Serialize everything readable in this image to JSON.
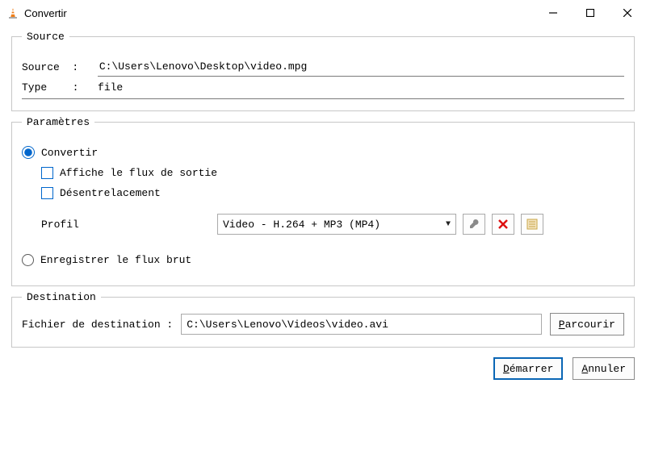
{
  "window": {
    "title": "Convertir",
    "controls": {
      "min": "−",
      "max": "▢",
      "close": "×"
    }
  },
  "source": {
    "legend": "Source",
    "source_label": "Source",
    "source_value": "C:\\Users\\Lenovo\\Desktop\\video.mpg",
    "type_label": "Type",
    "type_value": "file",
    "colon": "  :  "
  },
  "params": {
    "legend": "Paramètres",
    "convert_label": "Convertir",
    "show_output_label": "Affiche le flux de sortie",
    "deinterlace_label": "Désentrelacement",
    "profile_label": "Profil",
    "profile_selected": "Video - H.264 + MP3 (MP4)",
    "record_raw_label": "Enregistrer le flux brut"
  },
  "dest": {
    "legend": "Destination",
    "label": "Fichier de destination  :",
    "value": "C:\\Users\\Lenovo\\Videos\\video.avi",
    "browse_label": "Parcourir"
  },
  "footer": {
    "start_label": "Démarrer",
    "cancel_label": "Annuler"
  }
}
